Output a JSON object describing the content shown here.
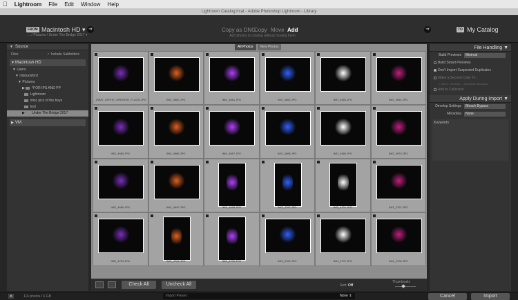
{
  "menubar": {
    "apple": "",
    "app": "Lightroom",
    "items": [
      "File",
      "Edit",
      "Window",
      "Help"
    ]
  },
  "window_title": "Lightroom Catalog.lrcat - Adobe Photoshop Lightroom - Library",
  "topbar": {
    "from_tag": "FROM",
    "source_title": "Macintosh HD ▾",
    "source_path": "... / Pictures / Under The Bridge 2017 ▾",
    "modes": [
      "Copy as DNG",
      "Copy",
      "Move",
      "Add"
    ],
    "active_mode": "Add",
    "mode_desc": "Add photos to catalog without moving them",
    "to_tag": "TO",
    "dest_title": "My Catalog"
  },
  "left": {
    "header": "Source",
    "files_label": "Files",
    "include_subfolders": "Include Subfolders",
    "volume1": "Macintosh HD",
    "tree": [
      {
        "label": "Users",
        "indent": 1,
        "selected": false
      },
      {
        "label": "mbdunsford",
        "indent": 2,
        "selected": false
      },
      {
        "label": "Pictures",
        "indent": 3,
        "selected": false
      },
      {
        "label": "*FOR IPS AND PP",
        "indent": 4,
        "selected": false
      },
      {
        "label": "Lightroom",
        "indent": 4,
        "selected": false
      },
      {
        "label": "misc pics of the boys",
        "indent": 4,
        "selected": false
      },
      {
        "label": "test",
        "indent": 4,
        "selected": false
      },
      {
        "label": "Under The Bridge 2017",
        "indent": 4,
        "selected": true
      }
    ],
    "volume2": "VM"
  },
  "grid": {
    "tabs": [
      "All Photos",
      "New Photos"
    ],
    "active_tab": "All Photos",
    "filenames": [
      "_DAVE_ONTHE_GREATER_FLAGG.JPG",
      "IMG_4660.JPG",
      "IMG_4661.JPG",
      "IMG_4662.JPG",
      "IMG_4663.JPG",
      "IMG_4664.JPG",
      "IMG_4665.JPG",
      "IMG_4666.JPG",
      "IMG_4667.JPG",
      "IMG_4668.JPG",
      "IMG_4669.JPG",
      "IMG_4670.JPG",
      "IMG_4686.JPG",
      "IMG_4697.JPG",
      "IMG_4698.JPG",
      "IMG_4700.JPG",
      "IMG_4701.JPG",
      "IMG_4702.JPG",
      "IMG_4703.JPG",
      "IMG_4704.JPG",
      "IMG_4705.JPG",
      "IMG_4706.JPG",
      "IMG_4707.JPG",
      "IMG_4708.JPG"
    ],
    "check_all": "Check All",
    "uncheck_all": "Uncheck All",
    "sort_label": "Sort:",
    "sort_value": "Off",
    "thumbnails_label": "Thumbnails"
  },
  "right": {
    "file_handling_header": "File Handling ▼",
    "build_previews_label": "Build Previews",
    "build_previews_value": "Minimal",
    "build_smart_previews": "Build Smart Previews",
    "dont_import_duplicates": "Don't Import Suspected Duplicates",
    "make_second_copy": "Make a Second Copy To :",
    "second_copy_path": "/ Users / mbduns... /Download Backups",
    "add_to_collection": "Add to Collection",
    "apply_header": "Apply During Import ▼",
    "develop_label": "Develop Settings",
    "develop_value": "Bleach Bypass",
    "metadata_label": "Metadata",
    "metadata_value": "None",
    "keywords_label": "Keywords"
  },
  "bottom": {
    "expand": "▲",
    "count": "116 photos / 6 GB",
    "preset_label": "Import Preset :",
    "preset_value": "None ⇕",
    "cancel": "Cancel",
    "import": "Import"
  },
  "colors": {
    "panel": "#333333",
    "grid_bg": "#8e8e8e",
    "cell_bg": "#a3a3a3",
    "selected_row": "#8a8a8a"
  }
}
